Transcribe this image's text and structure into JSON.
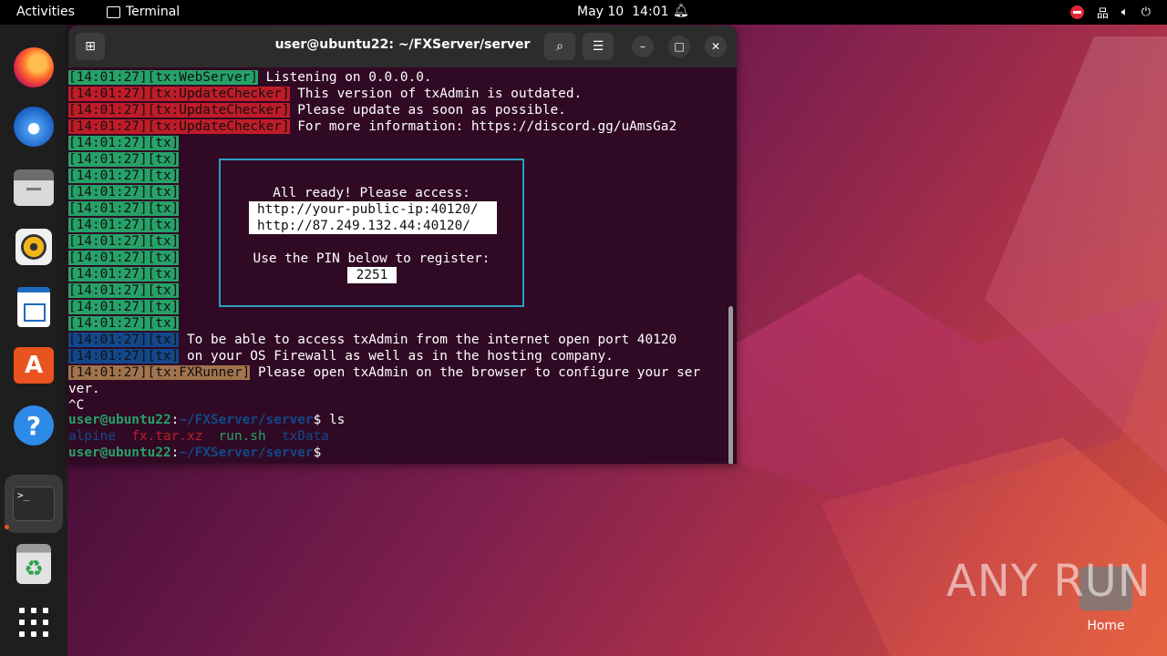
{
  "topbar": {
    "activities": "Activities",
    "app_name": "Terminal",
    "date": "May 10",
    "time": "14:01"
  },
  "dock": {
    "items": [
      "firefox",
      "thunderbird",
      "files",
      "rhythmbox",
      "libreoffice-writer",
      "app-center",
      "help",
      "terminal",
      "trash",
      "show-apps"
    ]
  },
  "window": {
    "title": "user@ubuntu22: ~/FXServer/server"
  },
  "terminal": {
    "lines": [
      {
        "tag": "[14:01:27][tx:WebServer]",
        "color": "green",
        "text": " Listening on 0.0.0.0."
      },
      {
        "tag": "[14:01:27][tx:UpdateChecker]",
        "color": "red",
        "text": " This version of txAdmin is outdated."
      },
      {
        "tag": "[14:01:27][tx:UpdateChecker]",
        "color": "red",
        "text": " Please update as soon as possible."
      },
      {
        "tag": "[14:01:27][tx:UpdateChecker]",
        "color": "red",
        "text": " For more information: https://discord.gg/uAmsGa2"
      },
      {
        "tag": "[14:01:27][tx]",
        "color": "green",
        "text": ""
      },
      {
        "tag": "[14:01:27][tx]",
        "color": "green",
        "text": ""
      },
      {
        "tag": "[14:01:27][tx]",
        "color": "green",
        "text": ""
      },
      {
        "tag": "[14:01:27][tx]",
        "color": "green",
        "text": ""
      },
      {
        "tag": "[14:01:27][tx]",
        "color": "green",
        "text": ""
      },
      {
        "tag": "[14:01:27][tx]",
        "color": "green",
        "text": ""
      },
      {
        "tag": "[14:01:27][tx]",
        "color": "green",
        "text": ""
      },
      {
        "tag": "[14:01:27][tx]",
        "color": "green",
        "text": ""
      },
      {
        "tag": "[14:01:27][tx]",
        "color": "green",
        "text": ""
      },
      {
        "tag": "[14:01:27][tx]",
        "color": "green",
        "text": ""
      },
      {
        "tag": "[14:01:27][tx]",
        "color": "green",
        "text": ""
      },
      {
        "tag": "[14:01:27][tx]",
        "color": "green",
        "text": ""
      },
      {
        "tag": "[14:01:27][tx]",
        "color": "blue",
        "text": " To be able to access txAdmin from the internet open port 40120"
      },
      {
        "tag": "[14:01:27][tx]",
        "color": "blue",
        "text": " on your OS Firewall as well as in the hosting company."
      },
      {
        "tag": "[14:01:27][tx:FXRunner]",
        "color": "brown",
        "text": " Please open txAdmin on the browser to configure your ser"
      },
      {
        "tag": "",
        "color": "",
        "text": "ver."
      },
      {
        "tag": "",
        "color": "",
        "text": "^C"
      }
    ],
    "panel": {
      "ready": "All ready! Please access:",
      "url1": "http://your-public-ip:40120/",
      "url2": "http://87.249.132.44:40120/",
      "pin_prompt": "Use the PIN below to register:",
      "pin": "2251"
    },
    "prompt_user": "user@ubuntu22",
    "prompt_sep": ":",
    "prompt_path": "~/FXServer/server",
    "prompt_dollar": "$ ",
    "cmd": "ls",
    "ls": {
      "dir1": "alpine",
      "archive": "fx.tar.xz",
      "exec": "run.sh",
      "dir2": "txData"
    }
  },
  "desktop": {
    "home_label": "Home",
    "watermark": "ANY RUN"
  }
}
